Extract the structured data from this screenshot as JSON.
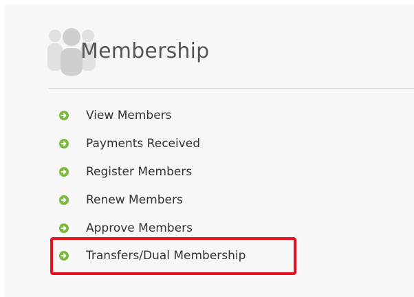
{
  "panel": {
    "title": "Membership",
    "icon": "group-icon"
  },
  "menu": {
    "bullet_icon": "arrow-right-circle-icon",
    "bullet_color": "#7cb93a",
    "items": [
      {
        "label": "View Members"
      },
      {
        "label": "Payments Received"
      },
      {
        "label": "Register Members"
      },
      {
        "label": "Renew Members"
      },
      {
        "label": "Approve Members"
      },
      {
        "label": "Transfers/Dual Membership"
      }
    ]
  },
  "highlight": {
    "target": "Transfers/Dual Membership",
    "color": "#e8111f"
  }
}
